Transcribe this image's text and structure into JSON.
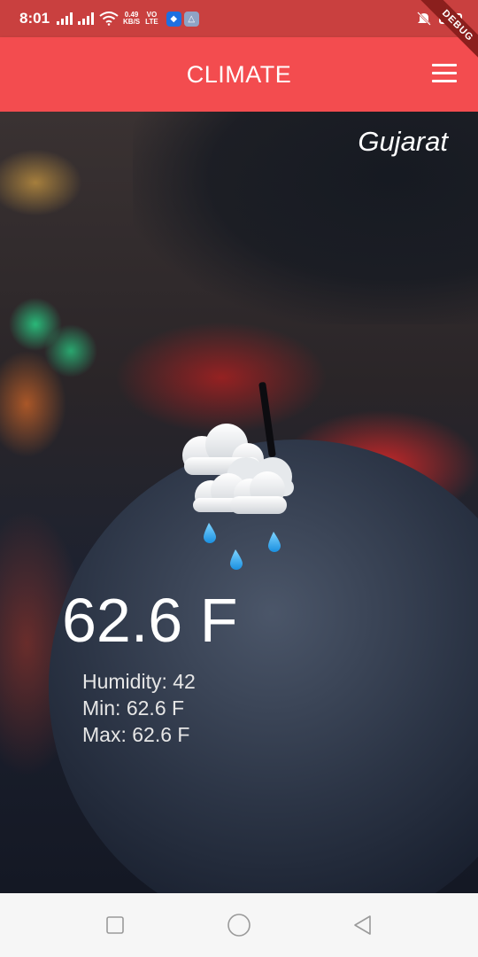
{
  "status_bar": {
    "time": "8:01",
    "net_speed_value": "0.49",
    "net_speed_unit": "KB/S",
    "volte_top": "VO",
    "volte_bottom": "LTE",
    "battery": "98"
  },
  "debug_banner": "DEBUG",
  "app_bar": {
    "title": "CLIMATE",
    "menu_icon": "menu-icon",
    "color": "#f34c4f"
  },
  "weather": {
    "city": "Gujarat",
    "icon": "rain-cloud-icon",
    "temperature": "62.6 F",
    "humidity": "Humidity: 42",
    "min": "Min: 62.6 F",
    "max": "Max: 62.6 F"
  },
  "nav_bar": {
    "buttons": [
      "recent-apps-icon",
      "home-icon",
      "back-icon"
    ]
  }
}
